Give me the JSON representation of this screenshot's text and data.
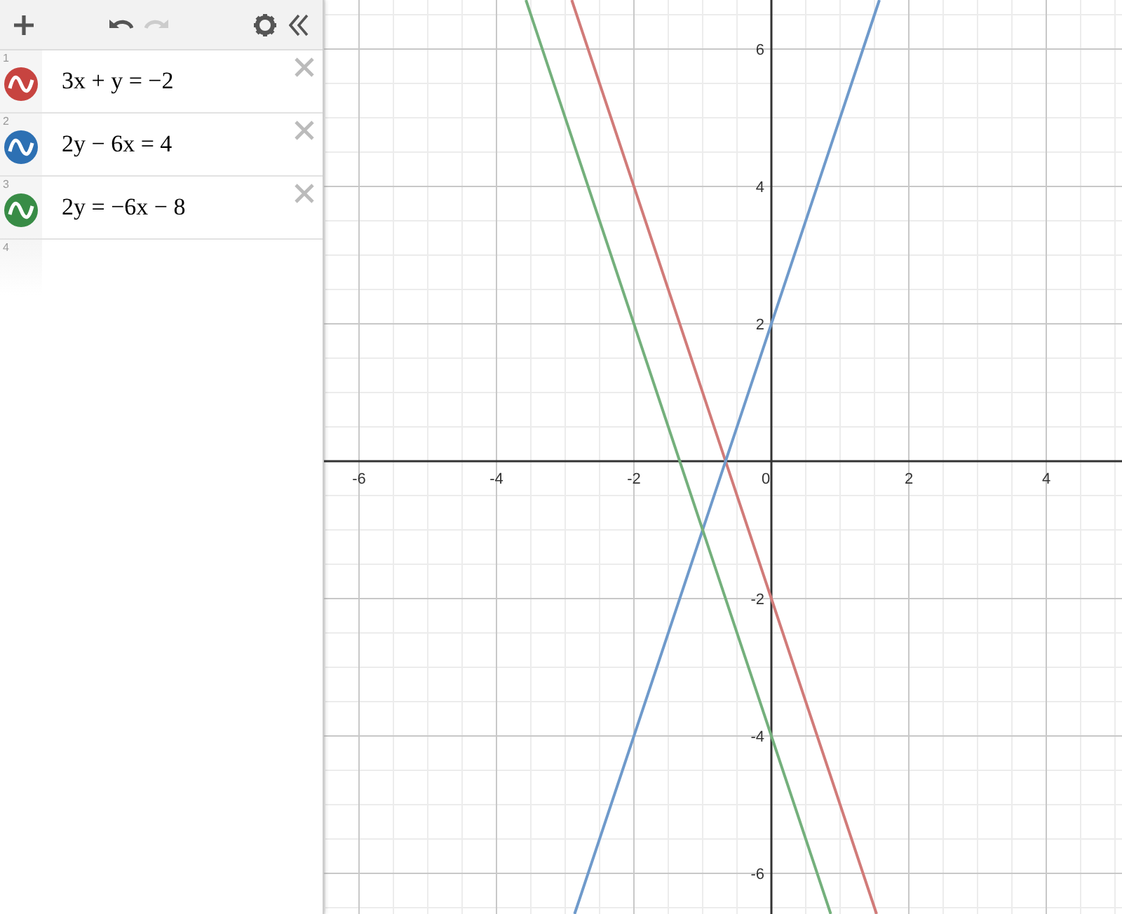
{
  "toolbar": [
    {
      "kind": "add",
      "disabled": false
    },
    {
      "kind": "undo",
      "disabled": false
    },
    {
      "kind": "redo",
      "disabled": true
    },
    {
      "kind": "settings",
      "disabled": false
    },
    {
      "kind": "collapse",
      "disabled": false
    }
  ],
  "expressions": [
    {
      "kind": "expression",
      "number": "1",
      "latex": "3x + y = −2",
      "color": "#c74440"
    },
    {
      "kind": "expression",
      "number": "2",
      "latex": "2y − 6x = 4",
      "color": "#2d70b3"
    },
    {
      "kind": "expression",
      "number": "3",
      "latex": "2y = −6x − 8",
      "color": "#388c46"
    },
    {
      "kind": "empty",
      "number": "4"
    }
  ],
  "graph": {
    "chart_data": {
      "type": "line",
      "grid": true,
      "x": [
        -3.5714,
        -2.9048,
        -2.8639,
        0.8639,
        1.5306,
        1.5714
      ],
      "xlim": [
        -6.5102,
        5.1224
      ],
      "ylim": [
        -6.5918,
        6.7143
      ],
      "xticks": [
        {
          "value": -6,
          "label": "-6"
        },
        {
          "value": -4,
          "label": "-4"
        },
        {
          "value": -2,
          "label": "-2"
        },
        {
          "value": 0,
          "label": "0"
        },
        {
          "value": 2,
          "label": "2"
        },
        {
          "value": 4,
          "label": "4"
        }
      ],
      "yticks": [
        {
          "value": -6,
          "label": "-6"
        },
        {
          "value": -4,
          "label": "-4"
        },
        {
          "value": -2,
          "label": "-2"
        },
        {
          "value": 2,
          "label": "2"
        },
        {
          "value": 4,
          "label": "4"
        },
        {
          "value": 6,
          "label": "6"
        }
      ],
      "series": [
        {
          "color": "#d17b79",
          "values": [
            null,
            6.7143,
            6.5917,
            -4.5917,
            -6.5918,
            null
          ]
        },
        {
          "color": "#6f9acb",
          "values": [
            null,
            null,
            -6.5917,
            4.5917,
            6.5918,
            6.7142
          ]
        },
        {
          "color": "#74b07c",
          "values": [
            6.7142,
            4.7144,
            4.5917,
            -6.5917,
            null,
            null
          ]
        }
      ]
    }
  }
}
